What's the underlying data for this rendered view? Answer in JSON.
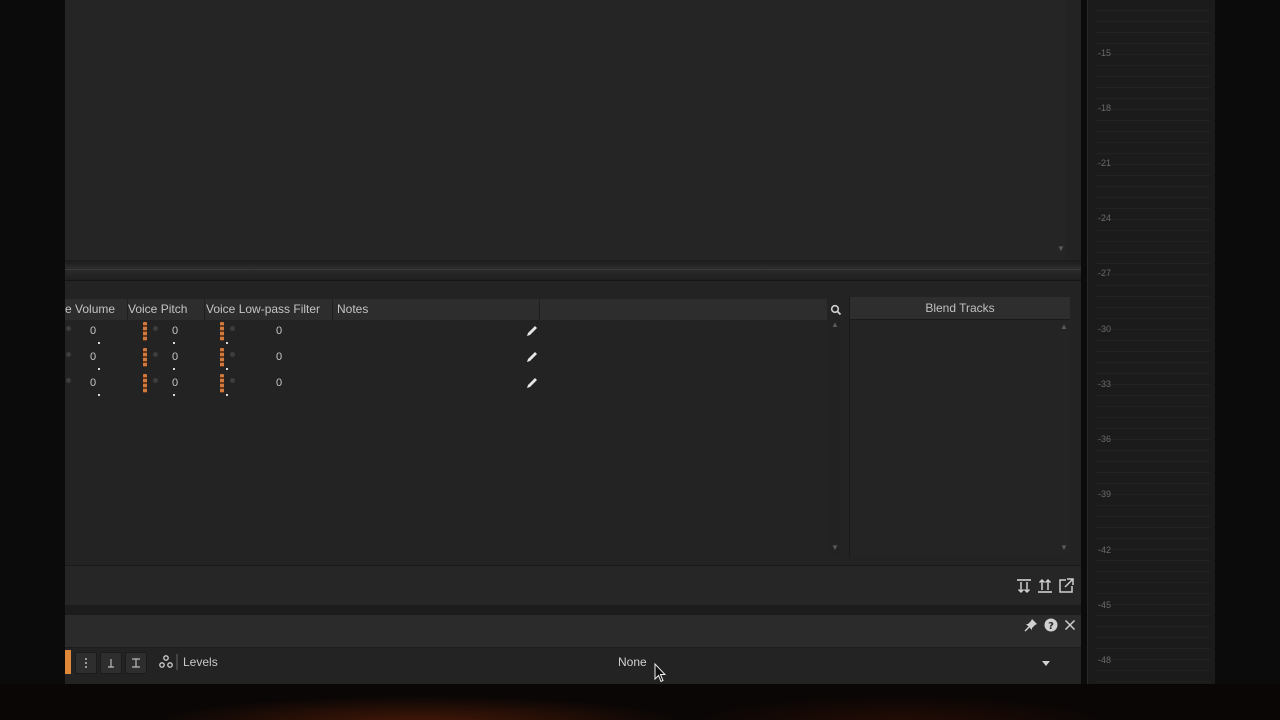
{
  "track_table": {
    "columns": [
      "e Volume",
      "Voice Pitch",
      "Voice Low-pass Filter",
      "Notes"
    ],
    "rows": [
      {
        "volume": "0",
        "pitch": "0",
        "lowpass": "0"
      },
      {
        "volume": "0",
        "pitch": "0",
        "lowpass": "0"
      },
      {
        "volume": "0",
        "pitch": "0",
        "lowpass": "0"
      }
    ]
  },
  "blend_panel": {
    "title": "Blend Tracks"
  },
  "levels_toolbar": {
    "label": "Levels",
    "preset_selected": "None"
  },
  "meter": {
    "labels": [
      "-15",
      "-18",
      "-21",
      "-24",
      "-27",
      "-30",
      "-33",
      "-36",
      "-39",
      "-42",
      "-45",
      "-48"
    ]
  },
  "icons": {
    "search": "search-icon",
    "edit": "pencil-icon",
    "pin": "pin-icon",
    "help": "help-icon",
    "close": "close-icon",
    "popout": "popout-icon"
  },
  "colors": {
    "accent": "#e0883a"
  }
}
